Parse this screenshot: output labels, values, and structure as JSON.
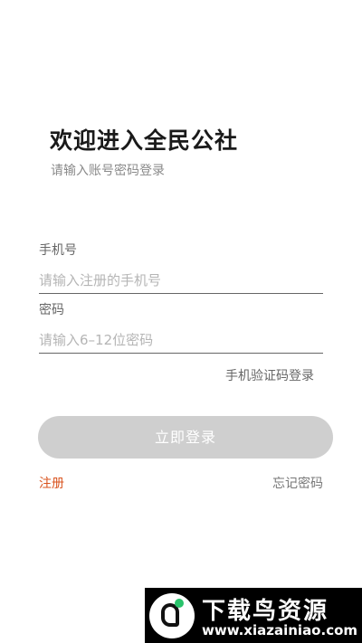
{
  "header": {
    "title": "欢迎进入全民公社",
    "subtitle": "请输入账号密码登录"
  },
  "form": {
    "phone": {
      "label": "手机号",
      "value": "",
      "placeholder": "请输入注册的手机号"
    },
    "password": {
      "label": "密码",
      "value": "",
      "placeholder": "请输入6–12位密码"
    },
    "sms_login_label": "手机验证码登录",
    "submit_label": "立即登录"
  },
  "footer": {
    "register_label": "注册",
    "forgot_label": "忘记密码"
  },
  "watermark": {
    "title": "下载鸟资源",
    "url": "www.xiazainiao.com"
  },
  "colors": {
    "accent": "#d9531e",
    "button_disabled": "#cfcfcf",
    "brand_dot": "#29c36b"
  }
}
